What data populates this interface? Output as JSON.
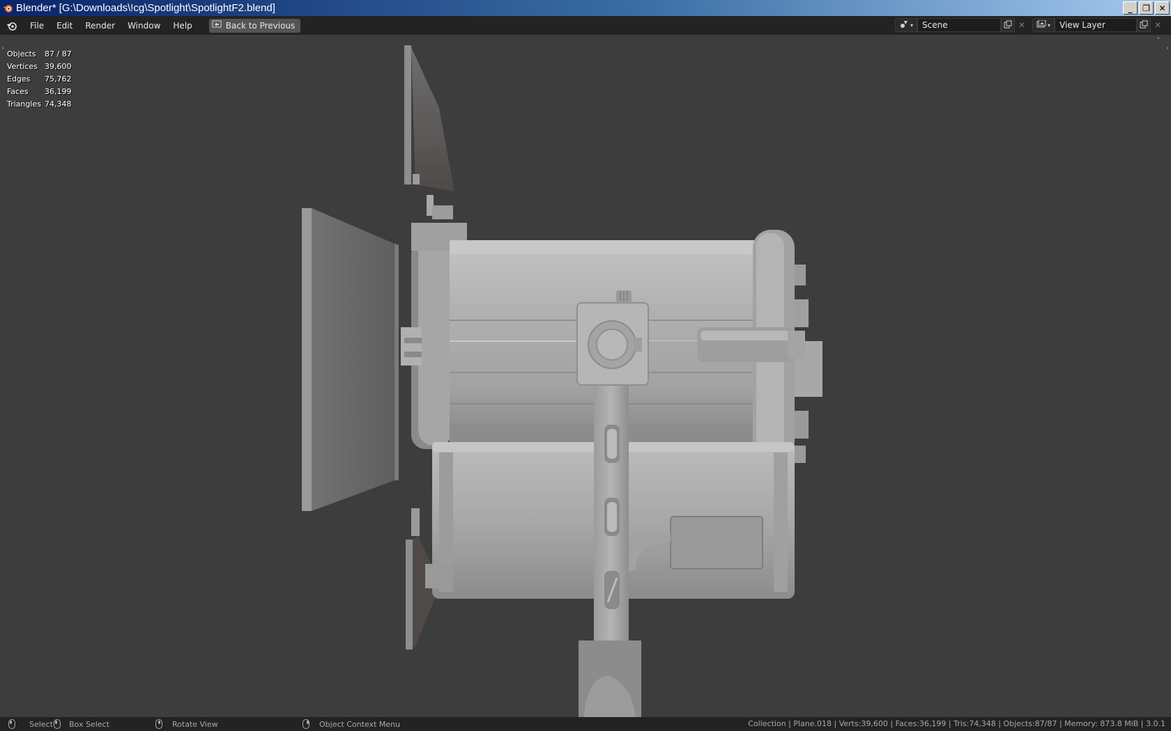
{
  "window": {
    "title": "Blender* [G:\\Downloads\\!cg\\Spotlight\\SpotlightF2.blend]",
    "buttons": {
      "minimize": "_",
      "maximize": "❐",
      "close": "✕"
    }
  },
  "topbar": {
    "menu": [
      "File",
      "Edit",
      "Render",
      "Window",
      "Help"
    ],
    "back_label": "Back to Previous",
    "scene_value": "Scene",
    "view_layer_value": "View Layer"
  },
  "stats": [
    {
      "label": "Objects",
      "value": "87 / 87"
    },
    {
      "label": "Vertices",
      "value": "39,600"
    },
    {
      "label": "Edges",
      "value": "75,762"
    },
    {
      "label": "Faces",
      "value": "36,199"
    },
    {
      "label": "Triangles",
      "value": "74,348"
    }
  ],
  "statusbar": {
    "hints": [
      "Select",
      "Box Select",
      "Rotate View",
      "Object Context Menu"
    ],
    "info": "Collection | Plane.018 | Verts:39,600 | Faces:36,199 | Tris:74,348 | Objects:87/87 | Memory: 873.8 MiB | 3.0.1"
  },
  "colors": {
    "viewport_bg": "#3d3d3d",
    "header_bg": "#232323",
    "model_base": "#a9a9a9"
  },
  "icons": {
    "app": "blender-icon",
    "back": "fullscreen-back-icon",
    "scene": "scene-icon",
    "view_layer": "view-layer-icon",
    "copy": "duplicate-icon",
    "remove": "close-icon"
  }
}
